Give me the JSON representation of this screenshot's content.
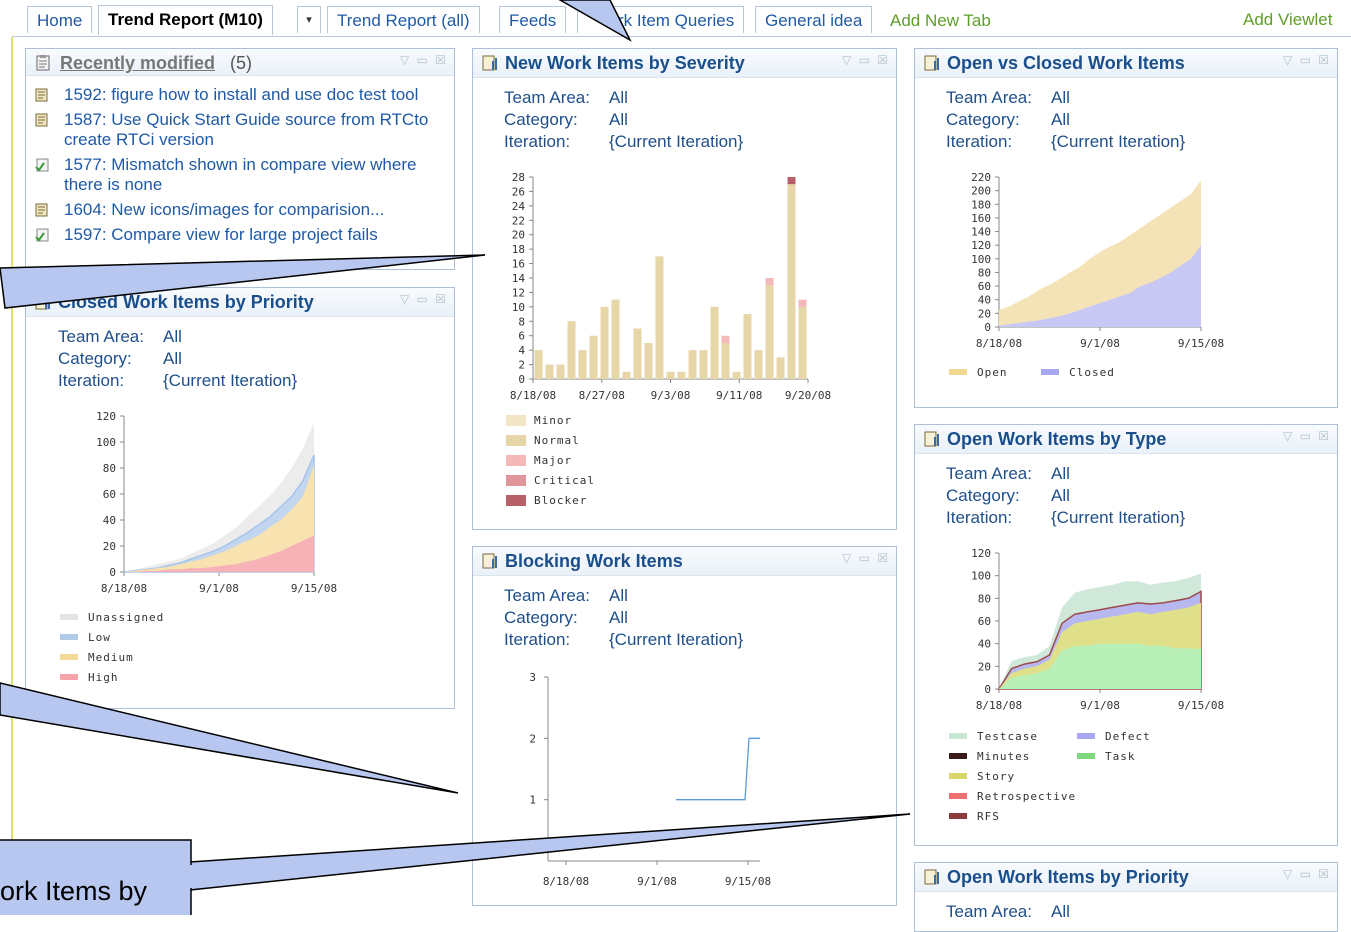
{
  "tabs": {
    "home": "Home",
    "trend_m10": "Trend Report (M10)",
    "dropdown": "▾",
    "trend_all": "Trend Report (all)",
    "feeds": "Feeds",
    "work_item_queries": "rk Item Queries",
    "general_idea": "General idea",
    "add_new_tab": "Add New Tab",
    "add_viewlet": "Add Viewlet"
  },
  "filters": {
    "team_area_label": "Team Area:",
    "category_label": "Category:",
    "iteration_label": "Iteration:",
    "team_area": "All",
    "category": "All",
    "iteration": "{Current Iteration}"
  },
  "widget_controls": "▽ ▭ ☒",
  "recently_modified": {
    "title": "Recently modified",
    "count": "(5)",
    "items": [
      {
        "text": "1592: figure how to install and use doc test tool",
        "icon": "task-icon"
      },
      {
        "text": "1587: Use Quick Start Guide source from RTCto create RTCi version",
        "icon": "task-icon"
      },
      {
        "text": "1577: Mismatch shown in compare view where there is none",
        "icon": "defect-icon"
      },
      {
        "text": "1604: New icons/images for comparision...",
        "icon": "task-icon"
      },
      {
        "text": "1597: Compare view for large project fails",
        "icon": "defect-icon"
      }
    ]
  },
  "callout_text": "ork Items by",
  "charts": {
    "severity": {
      "title": "New Work Items by Severity"
    },
    "open_closed": {
      "title": "Open vs Closed Work Items"
    },
    "closed_priority": {
      "title": "Closed Work Items by Priority"
    },
    "blocking": {
      "title": "Blocking Work Items"
    },
    "by_type": {
      "title": "Open Work Items by Type"
    },
    "open_priority": {
      "title": "Open Work Items by Priority"
    }
  },
  "chart_data": [
    {
      "type": "bar",
      "title": "New Work Items by Severity",
      "ylim": [
        0,
        28
      ],
      "yticks": [
        "0",
        "2",
        "4",
        "6",
        "8",
        "10",
        "12",
        "14",
        "16",
        "18",
        "20",
        "22",
        "24",
        "26",
        "28"
      ],
      "xticks": [
        "8/18/08",
        "8/27/08",
        "9/3/08",
        "9/11/08",
        "9/20/08"
      ],
      "colors": {
        "Minor": "#f2e6c6",
        "Normal": "#e6d6a8",
        "Major": "#f5b8b8",
        "Critical": "#e0959a",
        "Blocker": "#b8606a"
      },
      "series": [
        {
          "name": "Minor"
        },
        {
          "name": "Normal",
          "values": [
            4,
            2,
            2,
            8,
            4,
            6,
            10,
            11,
            1,
            7,
            5,
            17,
            1,
            1,
            4,
            4,
            10,
            5,
            1,
            9,
            4,
            13,
            3,
            27,
            10
          ]
        },
        {
          "name": "Major",
          "values": [
            0,
            0,
            0,
            0,
            0,
            0,
            0,
            0,
            0,
            0,
            0,
            0,
            0,
            0,
            0,
            0,
            0,
            1,
            0,
            0,
            0,
            1,
            0,
            0,
            1
          ]
        },
        {
          "name": "Critical"
        },
        {
          "name": "Blocker",
          "values": [
            0,
            0,
            0,
            0,
            0,
            0,
            0,
            0,
            0,
            0,
            0,
            0,
            0,
            0,
            0,
            0,
            0,
            0,
            0,
            0,
            0,
            0,
            0,
            1,
            0
          ]
        }
      ]
    },
    {
      "type": "area",
      "title": "Open vs Closed Work Items",
      "ylim": [
        0,
        220
      ],
      "yticks": [
        "0",
        "20",
        "40",
        "60",
        "80",
        "100",
        "120",
        "140",
        "160",
        "180",
        "200",
        "220"
      ],
      "xticks": [
        "8/18/08",
        "9/1/08",
        "9/15/08"
      ],
      "x_days": [
        0,
        3,
        6,
        9,
        12,
        15,
        18,
        21,
        24,
        27,
        30,
        33,
        36,
        39,
        42,
        45,
        48,
        51,
        54,
        57,
        60
      ],
      "colors": {
        "Open": "#f5e3b8",
        "Closed": "#c8c8f5"
      },
      "series": [
        {
          "name": "Open",
          "values": [
            25,
            30,
            38,
            45,
            55,
            62,
            70,
            80,
            88,
            100,
            110,
            118,
            125,
            135,
            145,
            155,
            165,
            175,
            185,
            195,
            215
          ]
        },
        {
          "name": "Closed",
          "values": [
            2,
            4,
            6,
            8,
            10,
            13,
            16,
            20,
            25,
            30,
            35,
            40,
            45,
            50,
            60,
            65,
            72,
            80,
            90,
            100,
            120
          ]
        }
      ]
    },
    {
      "type": "area",
      "title": "Closed Work Items by Priority",
      "ylim": [
        0,
        120
      ],
      "yticks": [
        "0",
        "20",
        "40",
        "60",
        "80",
        "100",
        "120"
      ],
      "xticks": [
        "8/18/08",
        "9/1/08",
        "9/15/08"
      ],
      "colors": {
        "Unassigned": "#ececec",
        "Low": "#c3d6ef",
        "Medium": "#f8e2b0",
        "High": "#f7b2b8"
      },
      "series": [
        {
          "name": "Unassigned",
          "values": [
            0,
            2,
            4,
            6,
            8,
            10,
            14,
            18,
            22,
            28,
            34,
            42,
            50,
            58,
            68,
            80,
            95,
            115
          ]
        },
        {
          "name": "Low",
          "values": [
            0,
            1,
            2,
            3,
            5,
            7,
            10,
            13,
            16,
            20,
            25,
            30,
            36,
            42,
            50,
            58,
            70,
            90
          ]
        },
        {
          "name": "Medium",
          "values": [
            0,
            1,
            2,
            3,
            4,
            6,
            8,
            10,
            13,
            16,
            20,
            24,
            28,
            34,
            40,
            48,
            58,
            82
          ]
        },
        {
          "name": "High",
          "values": [
            0,
            0,
            1,
            1,
            2,
            2,
            3,
            3,
            4,
            5,
            6,
            8,
            10,
            13,
            16,
            20,
            24,
            28
          ]
        }
      ]
    },
    {
      "type": "line",
      "title": "Blocking Work Items",
      "ylim": [
        0,
        3
      ],
      "yticks": [
        "1",
        "2",
        "3"
      ],
      "xticks": [
        "8/18/08",
        "9/1/08",
        "9/15/08"
      ],
      "colors": {
        "Blocking": "#5a9ad6"
      },
      "series": [
        {
          "values": [
            1,
            1,
            1,
            1,
            1,
            2,
            2
          ]
        }
      ]
    },
    {
      "type": "area",
      "title": "Open Work Items by Type",
      "ylim": [
        0,
        120
      ],
      "yticks": [
        "0",
        "20",
        "40",
        "60",
        "80",
        "100",
        "120"
      ],
      "xticks": [
        "8/18/08",
        "9/1/08",
        "9/15/08"
      ],
      "colors": {
        "Testcase": "#cfe8da",
        "Minutes": "#3a1a1a",
        "Story": "#e0e08a",
        "Retrospective": "#f07070",
        "RFS": "#8a3a3a",
        "Defect": "#b8b8f0",
        "Task": "#b8f0b8"
      },
      "series": [
        {
          "name": "Testcase",
          "values": [
            0,
            25,
            28,
            30,
            38,
            72,
            85,
            88,
            90,
            92,
            95,
            95,
            92,
            94,
            95,
            98,
            102
          ]
        },
        {
          "name": "Defect",
          "values": [
            0,
            18,
            22,
            24,
            30,
            58,
            66,
            68,
            70,
            72,
            74,
            76,
            75,
            76,
            78,
            80,
            86
          ]
        },
        {
          "name": "Story",
          "values": [
            0,
            14,
            18,
            20,
            26,
            50,
            58,
            60,
            62,
            64,
            66,
            68,
            66,
            68,
            70,
            72,
            76
          ]
        },
        {
          "name": "Task",
          "values": [
            0,
            10,
            12,
            14,
            18,
            34,
            38,
            38,
            40,
            40,
            40,
            40,
            38,
            38,
            36,
            36,
            35
          ]
        }
      ]
    }
  ]
}
